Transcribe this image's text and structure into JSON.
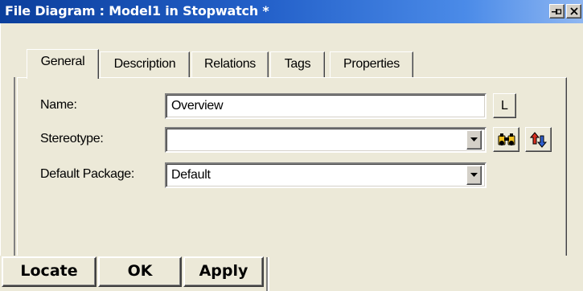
{
  "window": {
    "title": "File  Diagram : Model1 in Stopwatch *"
  },
  "tabs": [
    {
      "label": "General",
      "active": true
    },
    {
      "label": "Description",
      "active": false
    },
    {
      "label": "Relations",
      "active": false
    },
    {
      "label": "Tags",
      "active": false
    },
    {
      "label": "Properties",
      "active": false
    }
  ],
  "form": {
    "name_label": "Name:",
    "name_value": "Overview",
    "stereotype_label": "Stereotype:",
    "stereotype_value": "",
    "package_label": "Default Package:",
    "package_value": "Default",
    "l_button": "L"
  },
  "buttons": {
    "locate": "Locate",
    "ok": "OK",
    "apply": "Apply"
  },
  "colors": {
    "titlebar_start": "#0b3f9c",
    "titlebar_end": "#8fb7f2",
    "dialog_background": "#ece9d8"
  },
  "icons": {
    "pin": "pin-icon",
    "close": "close-icon",
    "browse": "binoculars-icon",
    "swap": "swap-arrows-icon",
    "dropdown": "chevron-down-icon"
  }
}
